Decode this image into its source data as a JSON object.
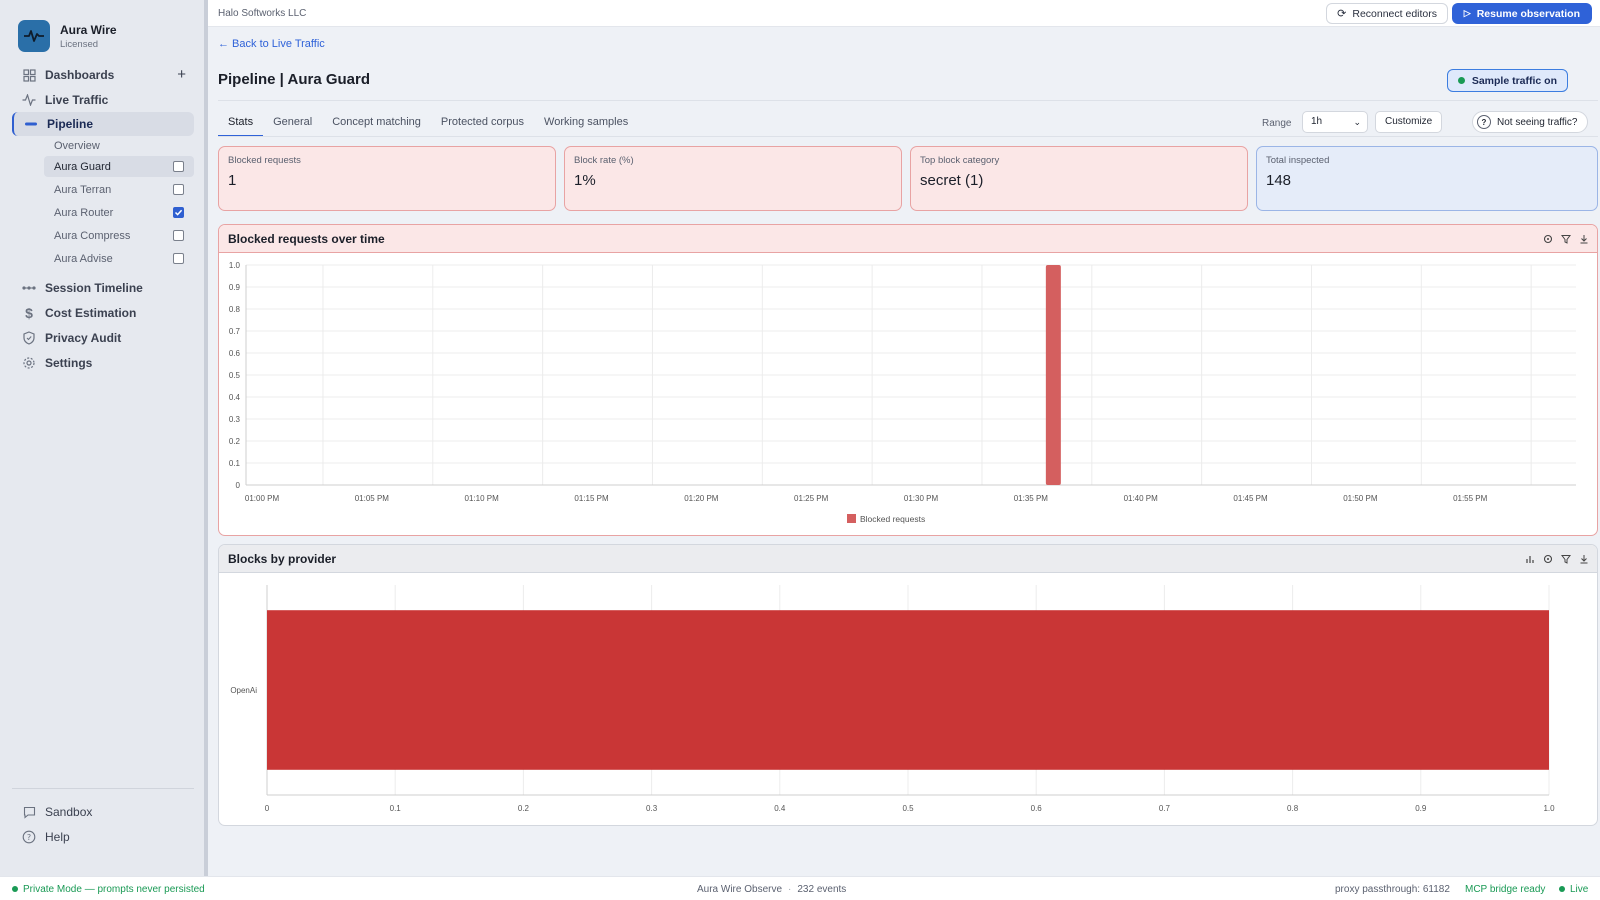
{
  "app": {
    "name": "Aura Wire",
    "license": "Licensed"
  },
  "sidebar": {
    "nav": [
      {
        "label": "Dashboards",
        "icon": "grid-icon"
      },
      {
        "label": "Live Traffic",
        "icon": "activity-icon"
      },
      {
        "label": "Pipeline",
        "icon": "pipeline-icon"
      },
      {
        "label": "Session Timeline",
        "icon": "timeline-icon"
      },
      {
        "label": "Cost Estimation",
        "icon": "dollar-icon"
      },
      {
        "label": "Privacy Audit",
        "icon": "shield-icon"
      },
      {
        "label": "Settings",
        "icon": "gear-icon"
      }
    ],
    "pipeline_items": [
      {
        "label": "Overview"
      },
      {
        "label": "Aura Guard",
        "checked": false
      },
      {
        "label": "Aura Terran",
        "checked": false
      },
      {
        "label": "Aura Router",
        "checked": true
      },
      {
        "label": "Aura Compress",
        "checked": false
      },
      {
        "label": "Aura Advise",
        "checked": false
      }
    ],
    "footer": [
      {
        "label": "Sandbox",
        "icon": "chat-icon"
      },
      {
        "label": "Help",
        "icon": "help-icon"
      }
    ]
  },
  "topbar": {
    "org": "Halo Softworks LLC",
    "reconnect": "Reconnect editors",
    "resume": "Resume observation"
  },
  "page": {
    "back": "← Back to Live Traffic",
    "title": "Pipeline | Aura Guard",
    "sample_traffic": "Sample traffic on",
    "tabs": [
      "Stats",
      "General",
      "Concept matching",
      "Protected corpus",
      "Working samples"
    ],
    "active_tab": "Stats",
    "range_label": "Range",
    "range_value": "1h",
    "customize": "Customize",
    "not_seeing": "Not seeing traffic?"
  },
  "cards": [
    {
      "label": "Blocked requests",
      "value": "1"
    },
    {
      "label": "Block rate (%)",
      "value": "1%"
    },
    {
      "label": "Top block category",
      "value": "secret (1)"
    },
    {
      "label": "Total inspected",
      "value": "148"
    }
  ],
  "chart_data": [
    {
      "type": "bar",
      "title": "Blocked requests over time",
      "x": [
        "01:00 PM",
        "01:05 PM",
        "01:10 PM",
        "01:15 PM",
        "01:20 PM",
        "01:25 PM",
        "01:30 PM",
        "01:35 PM",
        "01:40 PM",
        "01:45 PM",
        "01:50 PM",
        "01:55 PM"
      ],
      "series": [
        {
          "name": "Blocked requests",
          "points": [
            {
              "x": "01:35 PM",
              "y": 1
            }
          ]
        }
      ],
      "yticks": [
        "1.0",
        "0.9",
        "0.8",
        "0.7",
        "0.6",
        "0.5",
        "0.4",
        "0.3",
        "0.2",
        "0.1",
        "0"
      ],
      "ylim": [
        0,
        1
      ],
      "legend": "bottom",
      "grid": true,
      "color": "#d45f5f"
    },
    {
      "type": "bar",
      "orientation": "horizontal",
      "title": "Blocks by provider",
      "categories": [
        "OpenAi"
      ],
      "values": [
        1
      ],
      "xticks": [
        "0",
        "0.1",
        "0.2",
        "0.3",
        "0.4",
        "0.5",
        "0.6",
        "0.7",
        "0.8",
        "0.9",
        "1.0"
      ],
      "xlim": [
        0,
        1
      ],
      "grid": true,
      "color": "#c93636"
    }
  ],
  "statusbar": {
    "private_mode": "Private Mode — prompts never persisted",
    "observe": "Aura Wire Observe",
    "events": "232 events",
    "proxy": "proxy passthrough: 61182",
    "mcp": "MCP bridge ready",
    "live": "Live"
  }
}
